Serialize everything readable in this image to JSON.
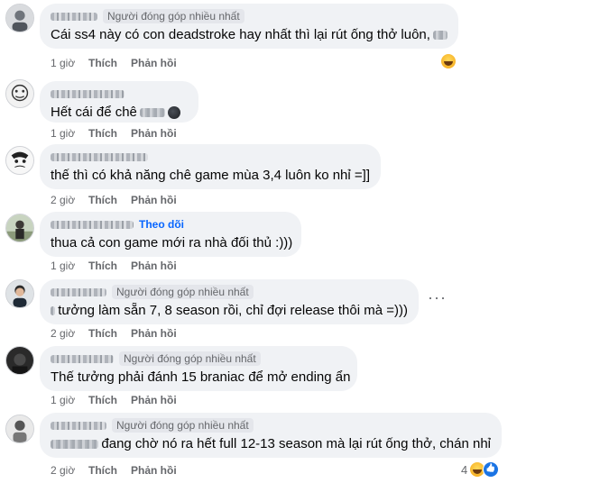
{
  "comments": [
    {
      "badge": "Người đóng góp nhiều nhất",
      "follow": "",
      "text": "Cái ss4 này có con deadstroke hay nhất thì lại rút ống thở luôn,",
      "time": "1 giờ",
      "like": "Thích",
      "reply": "Phản hồi"
    },
    {
      "badge": "",
      "follow": "",
      "text": "Hết cái để chê",
      "time": "1 giờ",
      "like": "Thích",
      "reply": "Phản hồi"
    },
    {
      "badge": "",
      "follow": "",
      "text": "thế thì có khả năng chê game mùa 3,4 luôn ko nhỉ =]]",
      "time": "2 giờ",
      "like": "Thích",
      "reply": "Phản hồi"
    },
    {
      "badge": "",
      "follow": "Theo dõi",
      "text": "thua cả con game mới ra nhà đối thủ :)))",
      "time": "1 giờ",
      "like": "Thích",
      "reply": "Phản hồi"
    },
    {
      "badge": "Người đóng góp nhiều nhất",
      "follow": "",
      "text": "tưởng làm sẵn 7, 8 season rồi, chỉ đợi release thôi mà =)))",
      "time": "2 giờ",
      "like": "Thích",
      "reply": "Phản hồi"
    },
    {
      "badge": "Người đóng góp nhiều nhất",
      "follow": "",
      "text": "Thế tưởng phải đánh 15 braniac để mở ending ẩn",
      "time": "1 giờ",
      "like": "Thích",
      "reply": "Phản hồi"
    },
    {
      "badge": "Người đóng góp nhiều nhất",
      "follow": "",
      "text": "đang chờ nó ra hết full 12-13 season mà lại rút ống thở, chán nhỉ",
      "time": "2 giờ",
      "like": "Thích",
      "reply": "Phản hồi",
      "reaction_count": "4"
    }
  ],
  "icons": {
    "laugh_reaction": "laugh-emoji-icon",
    "like_reaction": "like-emoji-icon",
    "more": "more-options-icon"
  },
  "colors": {
    "bubble": "#f0f2f5",
    "secondary_text": "#65676b",
    "follow_link": "#0866ff"
  }
}
